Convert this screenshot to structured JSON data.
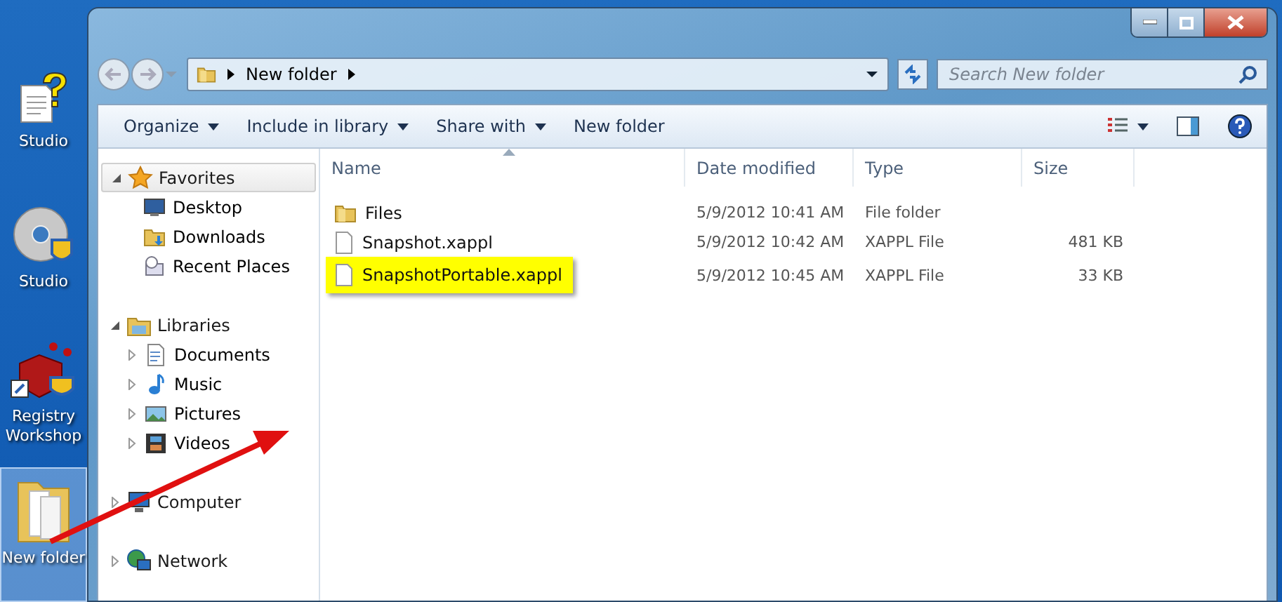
{
  "desktop_icons": [
    {
      "label": "Studio",
      "selected": false
    },
    {
      "label": "Studio",
      "selected": false
    },
    {
      "label": "Registry Workshop",
      "selected": false
    },
    {
      "label": "New folder",
      "selected": true
    }
  ],
  "address_bar": {
    "path": [
      "New folder"
    ]
  },
  "search": {
    "placeholder": "Search New folder"
  },
  "toolbar": {
    "buttons": [
      {
        "label": "Organize",
        "dropdown": true
      },
      {
        "label": "Include in library",
        "dropdown": true
      },
      {
        "label": "Share with",
        "dropdown": true
      },
      {
        "label": "New folder",
        "dropdown": false
      }
    ]
  },
  "navigation": [
    {
      "label": "Favorites",
      "expanded": true,
      "selected": true,
      "children": [
        {
          "label": "Desktop"
        },
        {
          "label": "Downloads"
        },
        {
          "label": "Recent Places"
        }
      ]
    },
    {
      "label": "Libraries",
      "expanded": true,
      "selected": false,
      "children": [
        {
          "label": "Documents"
        },
        {
          "label": "Music"
        },
        {
          "label": "Pictures"
        },
        {
          "label": "Videos"
        }
      ]
    },
    {
      "label": "Computer",
      "expanded": false,
      "selected": false
    },
    {
      "label": "Network",
      "expanded": false,
      "selected": false
    }
  ],
  "table": {
    "columns": [
      {
        "label": "Name",
        "sorted": true
      },
      {
        "label": "Date modified",
        "sorted": false
      },
      {
        "label": "Type",
        "sorted": false
      },
      {
        "label": "Size",
        "sorted": false
      }
    ],
    "rows": [
      {
        "kind": "folder",
        "name": "Files",
        "date": "5/9/2012 10:41 AM",
        "type": "File folder",
        "highlighted": false
      },
      {
        "kind": "file",
        "name": "Snapshot.xappl",
        "date": "5/9/2012 10:42 AM",
        "type": "XAPPL File",
        "size": "481 KB",
        "highlighted": false
      },
      {
        "kind": "file",
        "name": "SnapshotPortable.xappl",
        "date": "5/9/2012 10:45 AM",
        "type": "XAPPL File",
        "size": "33 KB",
        "highlighted": true
      }
    ]
  }
}
